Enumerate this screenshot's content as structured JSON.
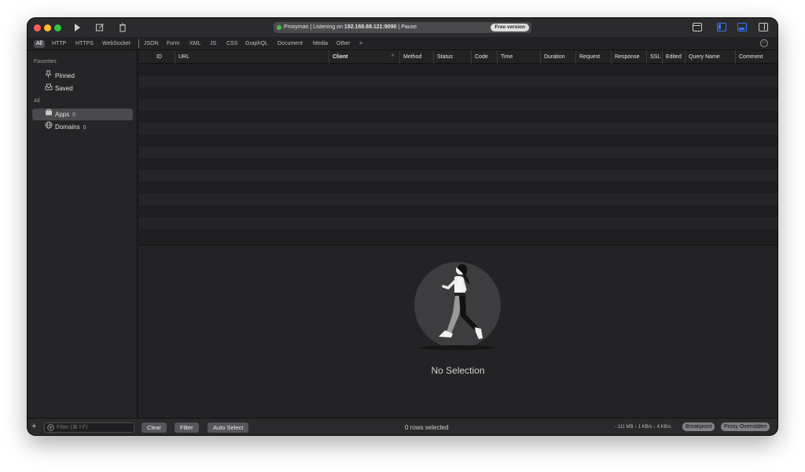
{
  "titlebar": {
    "status_prefix": "Proxyman | Listening on ",
    "status_address": "192.168.68.121:9090",
    "status_suffix": " | Pause",
    "free_badge": "Free version",
    "colors": {
      "close": "#ff5f57",
      "minimize": "#febc2e",
      "zoom": "#28c840",
      "listening_dot": "#43c24a",
      "accent": "#3478f6"
    }
  },
  "filters": {
    "tabs": [
      "All",
      "HTTP",
      "HTTPS",
      "WebSocket"
    ],
    "content_tabs": [
      "JSON",
      "Form",
      "XML",
      "JS",
      "CSS",
      "GraphQL",
      "Document",
      "Media",
      "Other"
    ],
    "more_glyph": ">",
    "options_glyph": "⋯"
  },
  "sidebar": {
    "favorites_header": "Favorites",
    "favorites": [
      {
        "label": "Pinned",
        "icon": "pin-icon"
      },
      {
        "label": "Saved",
        "icon": "saved-tray-icon"
      }
    ],
    "all_header": "All",
    "groups": [
      {
        "label": "Apps",
        "count": "0",
        "icon": "apps-icon",
        "selected": true
      },
      {
        "label": "Domains",
        "count": "0",
        "icon": "globe-icon",
        "selected": false
      }
    ]
  },
  "table": {
    "columns": [
      "ID",
      "URL",
      "Client",
      "Method",
      "Status",
      "Code",
      "Time",
      "Duration",
      "Request",
      "Response",
      "SSL",
      "Edited",
      "Query Name",
      "Comment"
    ],
    "sort_indicator": "^",
    "rows": []
  },
  "detail": {
    "empty_title": "No Selection"
  },
  "bottombar": {
    "add_glyph": "+",
    "filter_placeholder": "Filter (⌘⇧F)",
    "clear_label": "Clear",
    "filter_label": "Filter",
    "auto_select_label": "Auto Select",
    "rows_selected": "0 rows selected",
    "net_stats": "- 111 MB ↑ 1 KB/s ↓ 4 KB/s",
    "breakpoint_label": "Breakpoint",
    "proxy_overridden_label": "Proxy Overridden"
  }
}
